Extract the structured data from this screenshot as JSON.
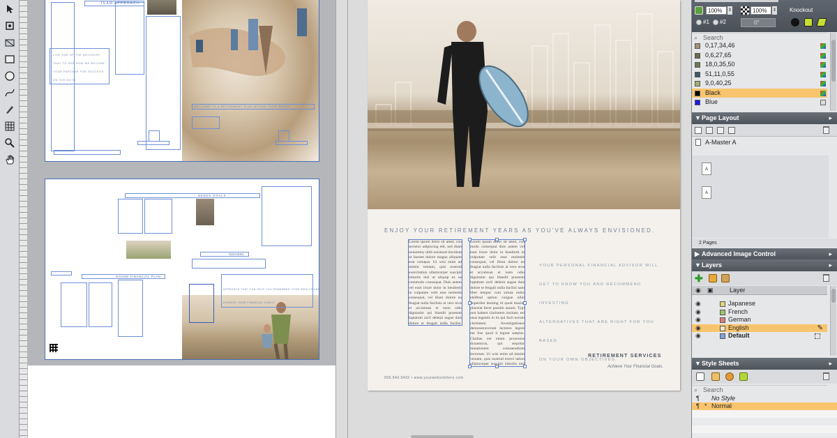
{
  "colors": {
    "accent": "#f8c56e",
    "frame": "#6d8fd6",
    "panel_header": "#5a6068"
  },
  "tools": [
    "pointer-icon",
    "rotate-icon",
    "crop-icon",
    "rectangle-icon",
    "oval-icon",
    "bezier-icon",
    "pen-icon",
    "table-icon",
    "zoom-icon",
    "hand-icon"
  ],
  "left_spread": {
    "top_heading": "TEAM APPROACH",
    "top_lines": [
      "LIVE ONE OF THE ADVISORS",
      "THAT TO SEE HOW WE BECOME",
      "YOUR PARTNER FOR SUCCESS",
      "ON THE BOTH"
    ],
    "top_caption": "WELCOME TO A RETIREMENT PLAN WITHIN YOUR REACH",
    "bottom_heading_left": "SOUND FINANCIAL PLAN.",
    "bottom_heading_center": "NEEDS GOALS",
    "bottom_heading_success": "SUCCESS.",
    "bottom_caption": "APPROACH THAT CAN HELP YOU REMEMBER YOUR WEALTH AND",
    "bottom_caption2": "ACHIEVE YOUR FINANCIAL GOALS"
  },
  "page": {
    "headline": "ENJOY YOUR RETIREMENT YEARS AS YOU'VE ALWAYS ENVISIONED.",
    "col1": "Lorem ipsum dolor sit amet, con sectetur adipiscing elit, sed diam nonummy nibh euismod tincidunt ut laoreet dolore magna aliquam erat volutpat. Ut wisi enim ad minim veniam, quis nostrud exercitation ullamcorper suscipit lobortis nisl ut aliquip ex ea commodo consequat. Duis autem vel eum iriure dolor in hendrerit in vulputate velit esse molestie consequat, vel illum dolore eu feugiat nulla facilisis at vero eros et accumsan et iusto odio dignissim qui blandit praesent luptatum zzril delenit augue duis dolore te feugait nulla facilisi. Lorem ipsum dolor sit amet, consectetuer adipiscing elit, sed diam nonummy nibh euismod tincidunt ut laoreet dolore magna aliquam erat volutpat.",
    "col2": "Lorem ipsum dolor sit amet, con modo consequat duis autem vel eum iriure dolor in hendrerit in vulputate velit esse molestie consequat, vel illum dolore eu feugiat nulla facilisis at vero eros et accumsan et iusto odio dignissim qui blandit praesent luptatum zzril delenit augue duis dolore te feugait nulla facilisi nam liber tempor cum soluta nobis eleifend option congue nihil imperdiet doming id quod mazim placerat facer possim assum. Typi non habent claritatem insitam; est usus legentis in iis qui facit eorum claritatem. Investigationes demonstraverunt lectores legere me lius quod ii legunt saepius. Claritas est etiam processus dynamicus, qui sequitur mutationem consuetudium lectorum. Ut wisi enim ad minim veniam, quis nostrud exerci tation ullamcorper suscipit lobortis nisl ut aliquip ex ea commodo consequat. Lorem ipsum dolor sit amet.",
    "side_lines": [
      "YOUR PERSONAL FINANCIAL ADVISOR WILL",
      "GET TO KNOW YOU AND RECOMMEND INVESTING",
      "ALTERNATIVES THAT ARE RIGHT FOR YOU BASED",
      "ON YOUR OWN OBJECTIVES."
    ],
    "retirement": "RETIREMENT SERVICES",
    "tagline": "Achieve Your Financial Goals.",
    "contact": "555.543.5432   •   www.yourwebsitehere.com"
  },
  "colors_palette": {
    "shade1": "100%",
    "shade2": "100%",
    "knockout": "Knockout",
    "radio1": "#1",
    "radio2": "#2",
    "angle": "0°",
    "search": "Search",
    "swatches": [
      {
        "name": "0,17,34,46",
        "color": "#a49376"
      },
      {
        "name": "0,6,27,65",
        "color": "#6f6a4c"
      },
      {
        "name": "18,0,35,50",
        "color": "#6b7a55"
      },
      {
        "name": "51,11,0,55",
        "color": "#3c5a6c"
      },
      {
        "name": "9,0,40,25",
        "color": "#a6b073"
      },
      {
        "name": "Black",
        "color": "#000000"
      },
      {
        "name": "Blue",
        "color": "#1a1ae6"
      }
    ]
  },
  "page_layout": {
    "title": "Page Layout",
    "master": "A-Master A",
    "page_a": "A",
    "page_count": "2 Pages"
  },
  "advanced_image": {
    "title": "Advanced Image Control"
  },
  "layers": {
    "title": "Layers",
    "header": "Layer",
    "items": [
      {
        "name": "Japanese",
        "color": "#e3d57a"
      },
      {
        "name": "French",
        "color": "#9dc56b"
      },
      {
        "name": "German",
        "color": "#e07c7c"
      },
      {
        "name": "English",
        "color": "#f3e3c5"
      },
      {
        "name": "Default",
        "color": "#7fa2e0"
      }
    ]
  },
  "style_sheets": {
    "title": "Style Sheets",
    "search": "Search",
    "items": [
      "No Style",
      "Normal"
    ],
    "normal_prefix": "*"
  }
}
